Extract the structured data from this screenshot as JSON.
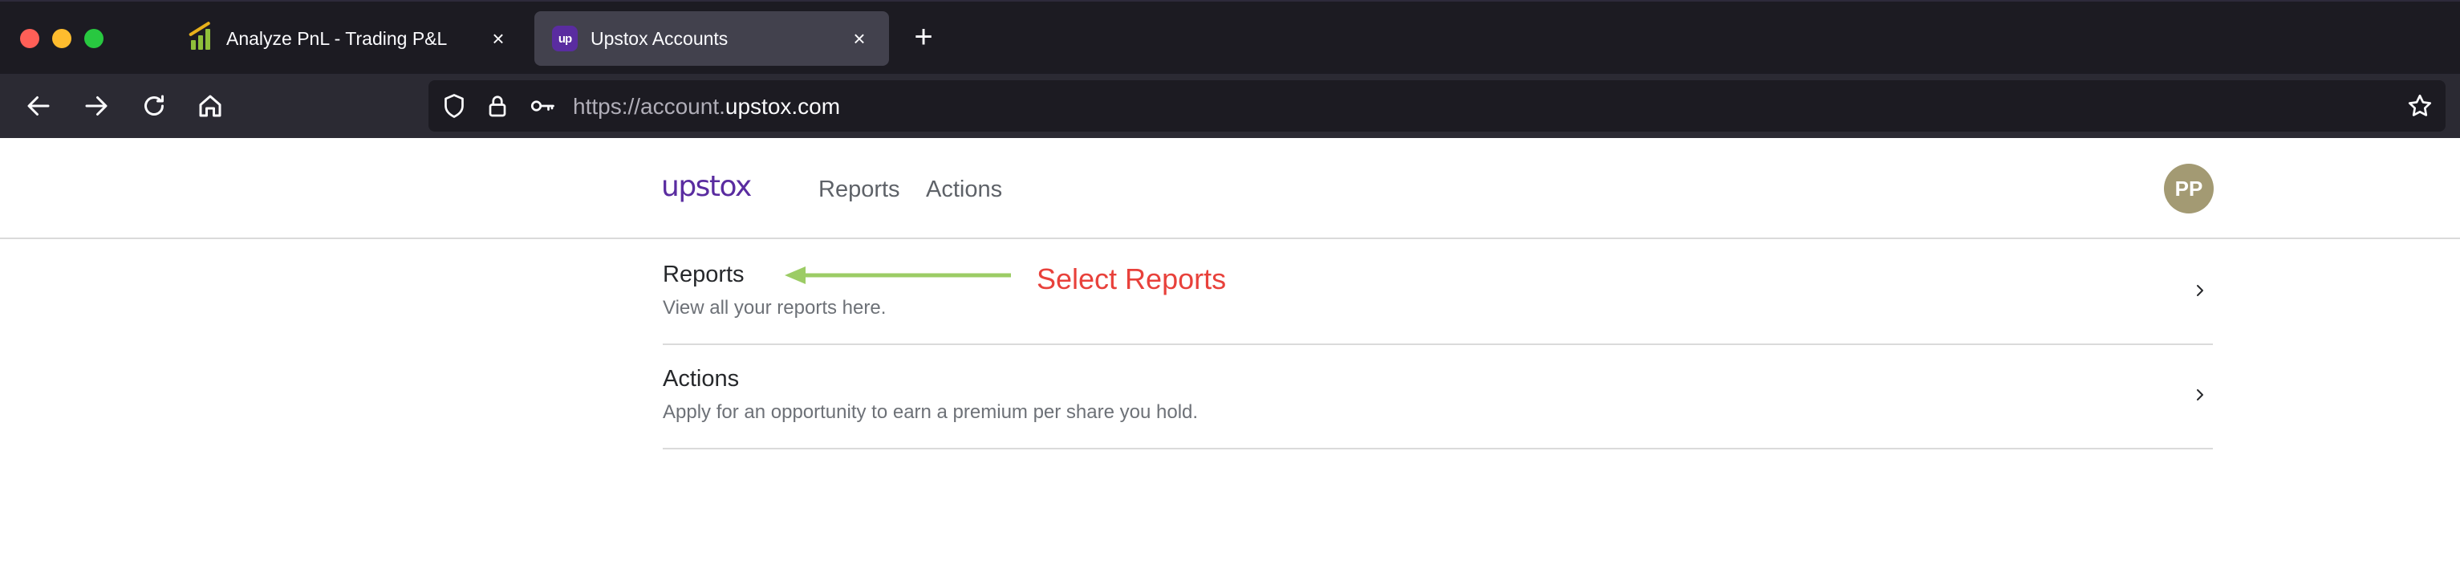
{
  "browser": {
    "tabs": [
      {
        "title": "Analyze PnL - Trading P&L",
        "icon": "chart-favicon-icon",
        "active": false
      },
      {
        "title": "Upstox Accounts",
        "icon": "upstox-favicon-icon",
        "favicon_text": "up",
        "active": true
      }
    ],
    "new_tab_label": "+",
    "close_label": "×",
    "url": {
      "dim": "https://account.",
      "domain": "upstox.com"
    }
  },
  "header": {
    "logo": "upstox",
    "nav": [
      {
        "label": "Reports"
      },
      {
        "label": "Actions"
      }
    ],
    "avatar_initials": "PP"
  },
  "rows": [
    {
      "title": "Reports",
      "description": "View all your reports here."
    },
    {
      "title": "Actions",
      "description": "Apply for an opportunity to earn a premium per share you hold."
    }
  ],
  "annotation": {
    "text": "Select Reports",
    "color": "#e8413b",
    "arrow_color": "#9ccc65"
  },
  "colors": {
    "brand": "#5a2ca0",
    "avatar": "#a39a73",
    "tab_active": "#42414d",
    "chrome": "#1c1b22"
  }
}
